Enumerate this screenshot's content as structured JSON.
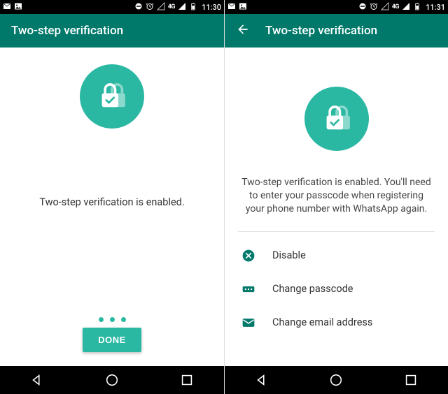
{
  "screenA": {
    "status": {
      "time": "11:30",
      "network": "4G"
    },
    "appbar": {
      "title": "Two-step verification"
    },
    "body_text": "Two-step verification is enabled.",
    "done_label": "DONE"
  },
  "screenB": {
    "status": {
      "time": "11:31",
      "network": "4G"
    },
    "appbar": {
      "title": "Two-step verification"
    },
    "body_text": "Two-step verification is enabled. You'll need to enter your passcode when registering your phone number with WhatsApp again.",
    "options": {
      "disable": "Disable",
      "change_passcode": "Change passcode",
      "change_email": "Change email address"
    }
  },
  "colors": {
    "primary": "#00796B",
    "accent": "#2BB8A3"
  }
}
